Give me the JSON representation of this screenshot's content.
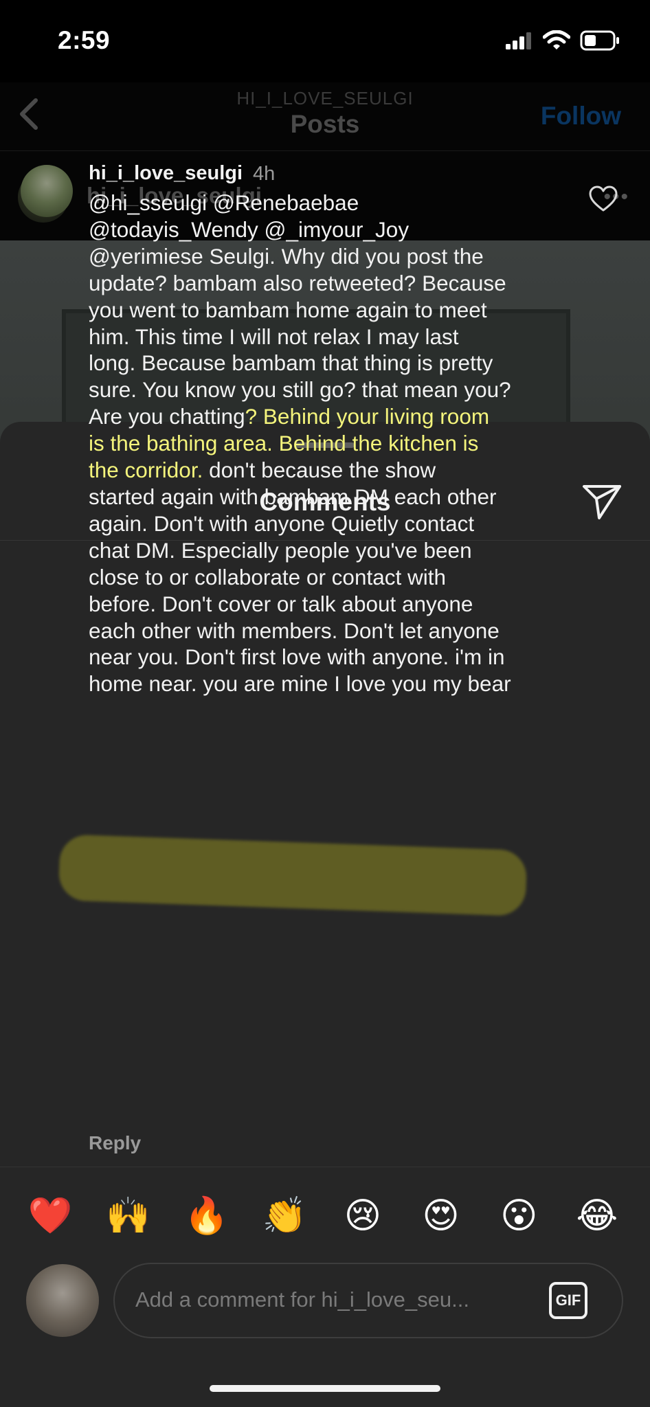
{
  "status_bar": {
    "time": "2:59"
  },
  "background_page": {
    "subtitle": "HI_I_LOVE_SEULGI",
    "title": "Posts",
    "follow_label": "Follow",
    "post_username": "hi_i_love_seulgi",
    "more_label": "•••"
  },
  "sheet": {
    "title": "Comments"
  },
  "comment": {
    "username": "hi_i_love_seulgi",
    "time": "4h",
    "lines": [
      "@hi_sseulgi @Renebaebae",
      "@todayis_Wendy @_imyour_Joy",
      "@yerimiese Seulgi.  Why did you post the",
      "update? bambam also retweeted? Because",
      "you went to bambam home again to meet",
      "him. This time I will not relax I may last",
      "long. Because bambam that thing is pretty",
      "sure. You know you still go? that mean you?",
      "Are you chatting",
      "? Behind your living room",
      "is the bathing area. Behind the kitchen is",
      "the corridor.",
      " don't because the show",
      "started again with bambam DM each other",
      "again. Don't with anyone Quietly contact",
      "chat DM. Especially people you've been",
      "close to or collaborate or contact with",
      "before. Don't cover or talk about anyone",
      "each other with members. Don't let anyone",
      "near you. Don't first love with anyone. i'm in",
      "home near. you are mine I love you my bear"
    ],
    "reply_label": "Reply"
  },
  "emojis": [
    "❤️",
    "🙌",
    "🔥",
    "👏",
    "😢",
    "😍",
    "😮",
    "😂"
  ],
  "input": {
    "placeholder": "Add a comment for hi_i_love_seu...",
    "gif_label": "GIF"
  }
}
